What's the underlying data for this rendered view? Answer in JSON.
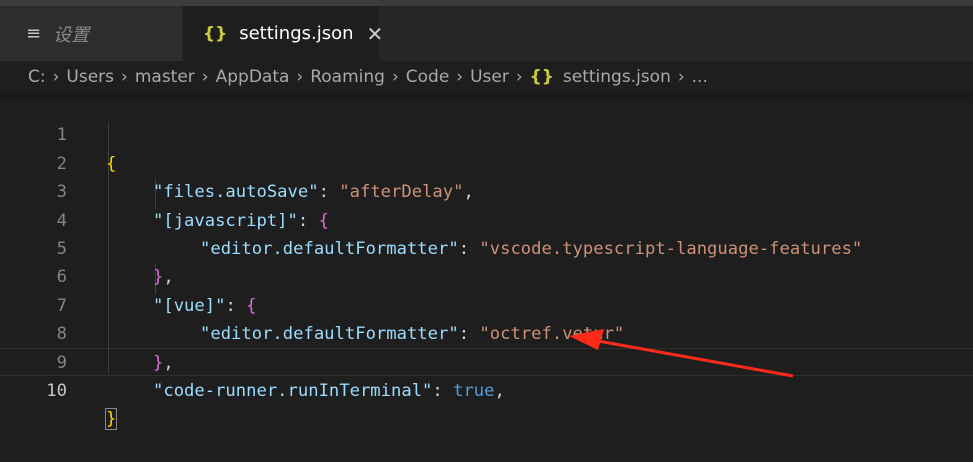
{
  "tabs": [
    {
      "icon": "≡",
      "label": "设置"
    },
    {
      "icon": "{}",
      "label": "settings.json",
      "close": "✕"
    }
  ],
  "breadcrumb": {
    "parts": [
      "C:",
      "Users",
      "master",
      "AppData",
      "Roaming",
      "Code",
      "User"
    ],
    "file_icon": "{}",
    "file": "settings.json",
    "ellipsis": "..."
  },
  "editor": {
    "line_numbers": [
      "1",
      "2",
      "3",
      "4",
      "5",
      "6",
      "7",
      "8",
      "9",
      "10"
    ],
    "lines": [
      {
        "text": "{"
      },
      {
        "key": "\"files.autoSave\"",
        "colon": ": ",
        "value": "\"afterDelay\"",
        "end": ","
      },
      {
        "key": "\"[javascript]\"",
        "colon": ": ",
        "brace": "{"
      },
      {
        "key": "\"editor.defaultFormatter\"",
        "colon": ": ",
        "value": "\"vscode.typescript-language-features\""
      },
      {
        "brace": "}",
        "end": ","
      },
      {
        "key": "\"[vue]\"",
        "colon": ": ",
        "brace": "{"
      },
      {
        "key": "\"editor.defaultFormatter\"",
        "colon": ": ",
        "value": "\"octref.vetur\""
      },
      {
        "brace": "}",
        "end": ","
      },
      {
        "key": "\"code-runner.runInTerminal\"",
        "colon": ": ",
        "value": "true",
        "end": ","
      },
      {
        "text": "}"
      }
    ]
  },
  "colors": {
    "annotation_arrow": "#ff2a1a",
    "key": "#9cdcfe",
    "string": "#ce9178",
    "bracket_outer": "#ffd700",
    "bracket_inner": "#da70d6",
    "keyword": "#569cd6"
  }
}
